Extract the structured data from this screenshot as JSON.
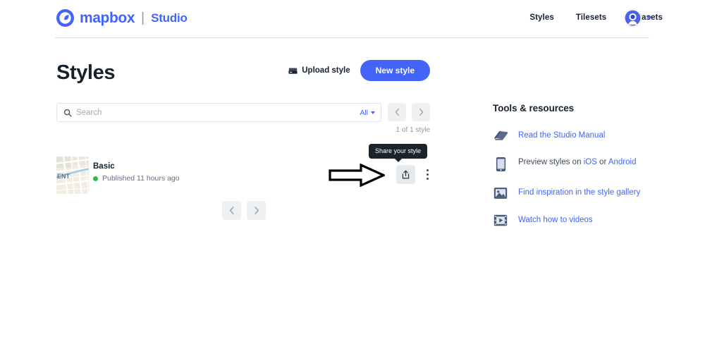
{
  "header": {
    "brand_name": "mapbox",
    "brand_separator": "|",
    "brand_product": "Studio",
    "logo_icon": "mapbox-logo-icon",
    "nav": [
      {
        "label": "Styles",
        "name": "nav-item-styles"
      },
      {
        "label": "Tilesets",
        "name": "nav-item-tilesets"
      },
      {
        "label": "Datasets",
        "name": "nav-item-datasets"
      }
    ],
    "avatar_icon": "user-avatar-icon",
    "account_caret_icon": "chevron-down-icon"
  },
  "page": {
    "title": "Styles",
    "upload_label": "Upload style",
    "upload_icon": "upload-drive-icon",
    "new_style_label": "New style"
  },
  "search": {
    "placeholder": "Search",
    "value": "",
    "search_icon": "search-icon",
    "filter_label": "All",
    "filter_caret_icon": "chevron-down-icon",
    "prev_icon": "chevron-left-icon",
    "next_icon": "chevron-right-icon",
    "count_text": "1 of 1 style"
  },
  "styles_list": [
    {
      "name": "Basic",
      "status": "Published 11 hours ago",
      "status_color": "#33b850",
      "thumbnail_label": "ENT",
      "share_icon": "share-icon",
      "menu_icon": "kebab-menu-icon"
    }
  ],
  "tooltip": {
    "text": "Share your style"
  },
  "pagination": {
    "prev_icon": "chevron-left-icon",
    "next_icon": "chevron-right-icon"
  },
  "tools": {
    "title": "Tools & resources",
    "items": [
      {
        "icon": "book-icon",
        "text": "Read the Studio Manual",
        "name": "tool-link-studio-manual",
        "style": "link"
      },
      {
        "icon": "mobile-phone-icon",
        "prefix": "Preview styles on ",
        "link1": "iOS",
        "middle": " or ",
        "link2": "Android",
        "name": "tool-link-preview-styles",
        "style": "mixed"
      },
      {
        "icon": "image-gallery-icon",
        "text": "Find inspiration in the style gallery",
        "name": "tool-link-style-gallery",
        "style": "link"
      },
      {
        "icon": "video-film-icon",
        "text": "Watch how to videos",
        "name": "tool-link-how-to-videos",
        "style": "link"
      }
    ]
  },
  "annotation": {
    "arrow_icon": "pointing-right-arrow-annotation"
  },
  "colors": {
    "brand_blue": "#4264fb",
    "text_dark": "#16222e",
    "text_muted": "#8d99a8",
    "published_green": "#33b850",
    "tooltip_bg": "#1b232b"
  }
}
